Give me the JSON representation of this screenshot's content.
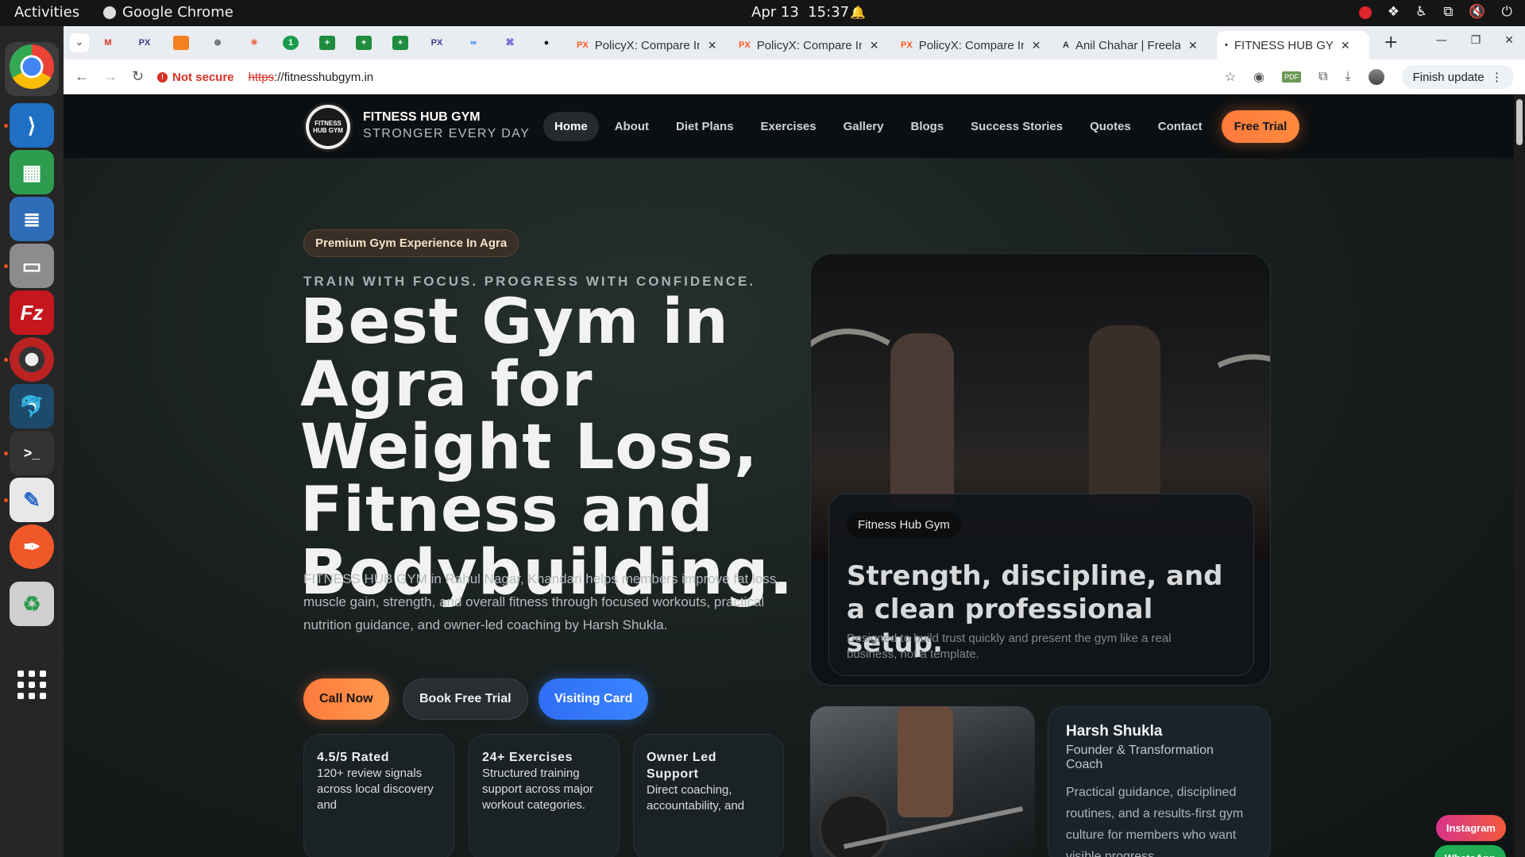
{
  "system": {
    "activities": "Activities",
    "app_name": "Google Chrome",
    "date": "Apr 13",
    "time": "15:37"
  },
  "dock": {
    "items": [
      "chrome-icon",
      "vscode-icon",
      "spreadsheet-icon",
      "document-icon",
      "files-icon",
      "filezilla-icon",
      "disk-utility-icon",
      "mysql-workbench-icon",
      "terminal-icon",
      "text-editor-icon",
      "pen-tool-icon",
      "trash-icon",
      "app-grid-icon"
    ]
  },
  "browser": {
    "pinned_tabs": [
      "M",
      "PX",
      "",
      "",
      "",
      "",
      "",
      "",
      "",
      "PX",
      "",
      "",
      ""
    ],
    "tabs": [
      {
        "favicon": "PX",
        "title": "PolicyX: Compare In"
      },
      {
        "favicon": "PX",
        "title": "PolicyX: Compare In"
      },
      {
        "favicon": "PX",
        "title": "PolicyX: Compare In"
      },
      {
        "favicon": "A",
        "title": "Anil Chahar | Freela"
      },
      {
        "favicon": "•",
        "title": "FITNESS HUB GYM |"
      }
    ],
    "address": {
      "warning": "Not secure",
      "scheme": "https",
      "rest": "://fitnesshubgym.in"
    },
    "finish_update": "Finish update"
  },
  "site": {
    "brand_title": "FITNESS HUB GYM",
    "brand_tagline": "STRONGER EVERY DAY",
    "logo_text": "FITNESS HUB GYM",
    "menu": [
      "Home",
      "About",
      "Diet Plans",
      "Exercises",
      "Gallery",
      "Blogs",
      "Success Stories",
      "Quotes",
      "Contact"
    ],
    "menu_cta": "Free Trial",
    "hero": {
      "pill": "Premium Gym Experience In Agra",
      "eyebrow": "TRAIN WITH FOCUS. PROGRESS WITH CONFIDENCE.",
      "headline": "Best Gym in Agra for Weight Loss, Fitness and Bodybuilding.",
      "lede": "FITNESS HUB GYM in Rahul Nagar, Khandari helps members improve fat loss, muscle gain, strength, and overall fitness through focused workouts, practical nutrition guidance, and owner-led coaching by Harsh Shukla.",
      "cta_call": "Call Now",
      "cta_book": "Book Free Trial",
      "cta_visit": "Visiting Card"
    },
    "stats": [
      {
        "title": "4.5/5 Rated",
        "desc": "120+ review signals across local discovery and"
      },
      {
        "title": "24+ Exercises",
        "desc": "Structured training support across major workout categories."
      },
      {
        "title": "Owner Led Support",
        "desc": "Direct coaching, accountability, and"
      }
    ],
    "feature_card": {
      "tag": "Fitness Hub Gym",
      "heading": "Strength, discipline, and a clean professional setup.",
      "text": "Designed to build trust quickly and present the gym like a real business, not a template."
    },
    "coach": {
      "name": "Harsh Shukla",
      "role": "Founder & Transformation Coach",
      "desc": "Practical guidance, disciplined routines, and a results-first gym culture for members who want visible progress."
    },
    "floating": {
      "instagram": "Instagram",
      "whatsapp": "WhatsApp"
    }
  }
}
